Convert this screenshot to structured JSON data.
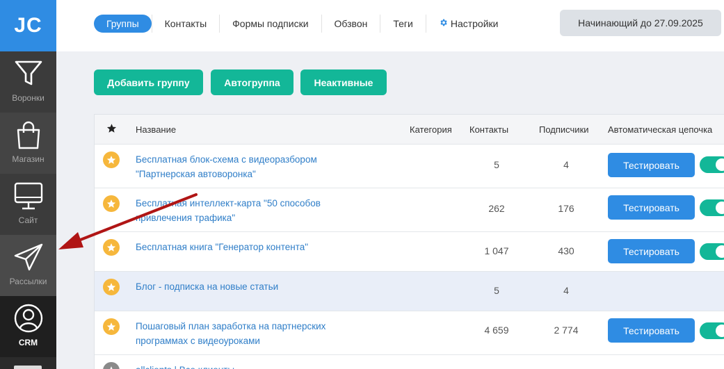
{
  "sidebar": {
    "logo": "JC",
    "items": [
      {
        "label": "Воронки",
        "icon": "funnel-icon"
      },
      {
        "label": "Магазин",
        "icon": "shopping-bag-icon"
      },
      {
        "label": "Сайт",
        "icon": "monitor-icon"
      },
      {
        "label": "Рассылки",
        "icon": "paper-plane-icon"
      },
      {
        "label": "CRM",
        "icon": "user-icon"
      }
    ]
  },
  "topbar": {
    "tabs": [
      {
        "label": "Группы",
        "active": true
      },
      {
        "label": "Контакты",
        "active": false
      },
      {
        "label": "Формы подписки",
        "active": false
      },
      {
        "label": "Обзвон",
        "active": false
      },
      {
        "label": "Теги",
        "active": false
      },
      {
        "label": "Настройки",
        "active": false,
        "icon": "gear-icon"
      }
    ],
    "plan": "Начинающий до 27.09.2025"
  },
  "actions": {
    "add_group": "Добавить группу",
    "autogroup": "Автогруппа",
    "inactive": "Неактивные"
  },
  "table": {
    "headers": {
      "name": "Название",
      "category": "Категория",
      "contacts": "Контакты",
      "subscribers": "Подписчики",
      "auto_chain": "Автоматическая цепочка"
    },
    "rows": [
      {
        "name": "Бесплатная блок-схема с видеоразбором \"Партнерская автоворонка\"",
        "category": "",
        "contacts": "5",
        "subscribers": "4",
        "action": "Тестировать",
        "chain_on": true
      },
      {
        "name": "Бесплатная интеллект-карта \"50 способов привлечения трафика\"",
        "category": "",
        "contacts": "262",
        "subscribers": "176",
        "action": "Тестировать",
        "chain_on": true
      },
      {
        "name": "Бесплатная книга \"Генератор контента\"",
        "category": "",
        "contacts": "1 047",
        "subscribers": "430",
        "action": "Тестировать",
        "chain_on": true
      },
      {
        "name": "Блог - подписка на новые статьи",
        "category": "",
        "contacts": "5",
        "subscribers": "4",
        "action": "",
        "chain_on": false
      },
      {
        "name": "Пошаговый план заработка на партнерских программах с видеоуроками",
        "category": "",
        "contacts": "4 659",
        "subscribers": "2 774",
        "action": "Тестировать",
        "chain_on": true
      },
      {
        "name": "allclients | Все клиенты",
        "category": "",
        "contacts": "",
        "subscribers": "",
        "action": "",
        "chain_on": false
      }
    ]
  },
  "colors": {
    "accent_blue": "#2f8ce3",
    "accent_green": "#13b798",
    "star": "#f6b73c",
    "arrow": "#b01515"
  }
}
